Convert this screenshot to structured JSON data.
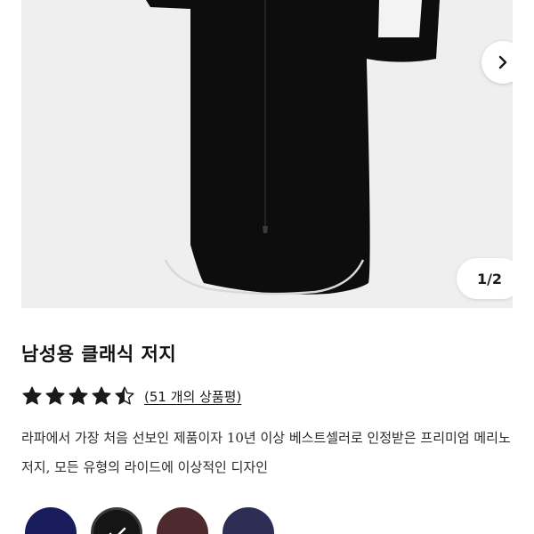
{
  "gallery": {
    "counter": "1/2",
    "next_icon": "chevron-right-icon"
  },
  "product": {
    "title": "남성용 클래식 저지",
    "rating": 4.5,
    "reviews_label": "(51 개의 상품평)",
    "description": "라파에서 가장 처음 선보인 제품이자 10년 이상 베스트셀러로 인정받은 프리미엄 메리노 저지, 모든 유형의 라이드에 이상적인 디자인"
  },
  "swatches": [
    {
      "name": "navy",
      "color": "#1a1d5c",
      "selected": false
    },
    {
      "name": "black",
      "color": "#151515",
      "selected": true
    },
    {
      "name": "burgundy",
      "color": "#4e2a2e",
      "selected": false
    },
    {
      "name": "dark-blue",
      "color": "#2e2d55",
      "selected": false
    }
  ]
}
